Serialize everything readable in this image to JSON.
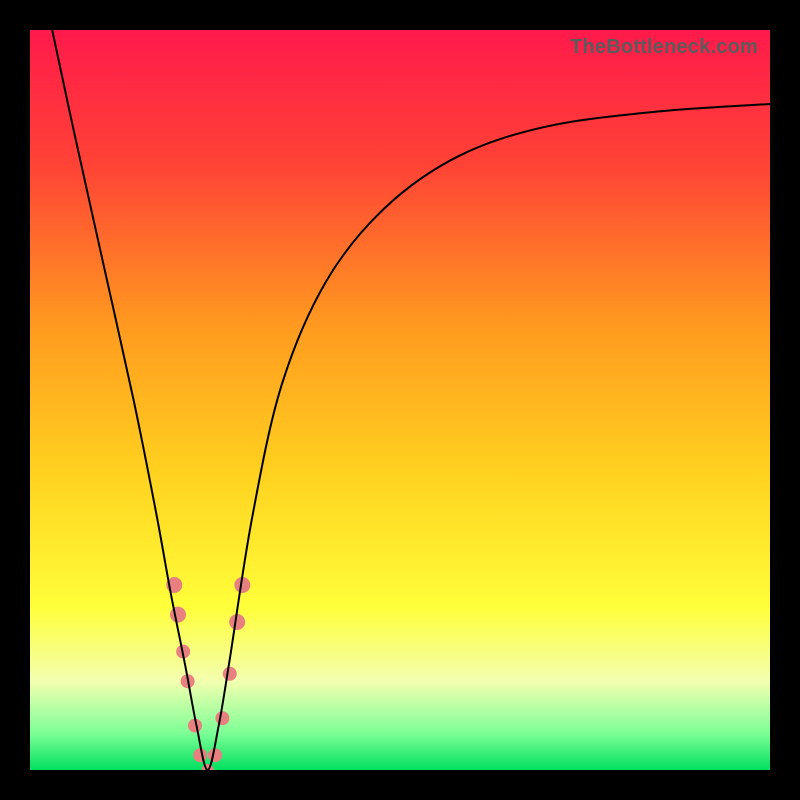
{
  "watermark": "TheBottleneck.com",
  "chart_data": {
    "type": "line",
    "title": "",
    "xlabel": "",
    "ylabel": "",
    "xlim": [
      0,
      100
    ],
    "ylim": [
      0,
      100
    ],
    "legend": false,
    "grid": false,
    "background_gradient_stops": [
      {
        "offset": 0.0,
        "color": "#ff1a4b"
      },
      {
        "offset": 0.18,
        "color": "#ff4236"
      },
      {
        "offset": 0.4,
        "color": "#ff9a1f"
      },
      {
        "offset": 0.6,
        "color": "#ffd21f"
      },
      {
        "offset": 0.78,
        "color": "#ffff3a"
      },
      {
        "offset": 0.88,
        "color": "#f3ffb0"
      },
      {
        "offset": 0.95,
        "color": "#7dff96"
      },
      {
        "offset": 1.0,
        "color": "#00e060"
      }
    ],
    "series": [
      {
        "name": "bottleneck-curve",
        "stroke": "#000000",
        "stroke_width": 2,
        "x": [
          3,
          6,
          10,
          14,
          17,
          19,
          21,
          22.5,
          24,
          25.5,
          27,
          30,
          34,
          40,
          48,
          58,
          70,
          85,
          100
        ],
        "y": [
          100,
          86,
          68,
          50,
          35,
          24,
          14,
          6,
          0,
          6,
          15,
          34,
          52,
          66,
          76,
          83,
          87,
          89,
          90
        ]
      }
    ],
    "markers": {
      "name": "highlight-dots",
      "color": "#e98080",
      "radius_major": 8,
      "radius_minor": 6,
      "points": [
        {
          "x": 19.5,
          "y": 25,
          "r": 8
        },
        {
          "x": 20.0,
          "y": 21,
          "r": 8
        },
        {
          "x": 20.7,
          "y": 16,
          "r": 7
        },
        {
          "x": 21.3,
          "y": 12,
          "r": 7
        },
        {
          "x": 22.3,
          "y": 6,
          "r": 7
        },
        {
          "x": 23.0,
          "y": 2,
          "r": 7
        },
        {
          "x": 24.0,
          "y": 0,
          "r": 6
        },
        {
          "x": 25.0,
          "y": 2,
          "r": 7
        },
        {
          "x": 26.0,
          "y": 7,
          "r": 7
        },
        {
          "x": 27.0,
          "y": 13,
          "r": 7
        },
        {
          "x": 28.0,
          "y": 20,
          "r": 8
        },
        {
          "x": 28.7,
          "y": 25,
          "r": 8
        }
      ]
    }
  }
}
